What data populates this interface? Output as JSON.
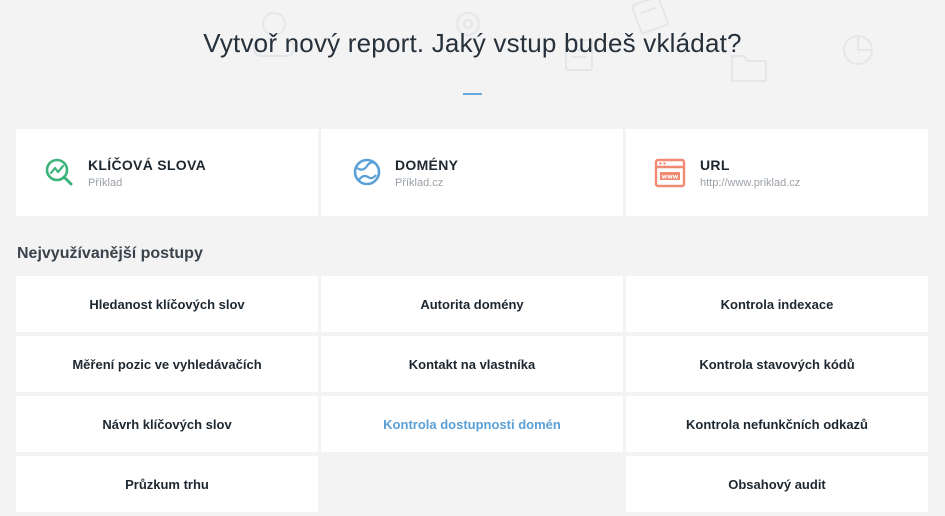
{
  "page": {
    "title": "Vytvoř nový report. Jaký vstup budeš vkládat?",
    "accent_color": "#6aa9de"
  },
  "input_types": [
    {
      "title": "KLÍČOVÁ SLOVA",
      "example": "Příklad",
      "icon": "keyword-search-icon",
      "color": "#3cb37a"
    },
    {
      "title": "DOMÉNY",
      "example": "Příklad.cz",
      "icon": "globe-icon",
      "color": "#5a9fd6"
    },
    {
      "title": "URL",
      "example": "http://www.priklad.cz",
      "icon": "browser-www-icon",
      "color": "#f08a73"
    }
  ],
  "section": {
    "heading": "Nejvyužívanější postupy"
  },
  "procedures": [
    [
      "Hledanost klíčových slov",
      "Autorita domény",
      "Kontrola indexace"
    ],
    [
      "Měření pozic ve vyhledávačích",
      "Kontakt na vlastníka",
      "Kontrola stavových kódů"
    ],
    [
      "Návrh klíčových slov",
      "Kontrola dostupnosti domén",
      "Kontrola nefunkčních odkazů"
    ],
    [
      "Průzkum trhu",
      "",
      "Obsahový audit"
    ]
  ],
  "highlighted_procedure": "Kontrola dostupnosti domén",
  "highlight_color": "#5a9fd6"
}
